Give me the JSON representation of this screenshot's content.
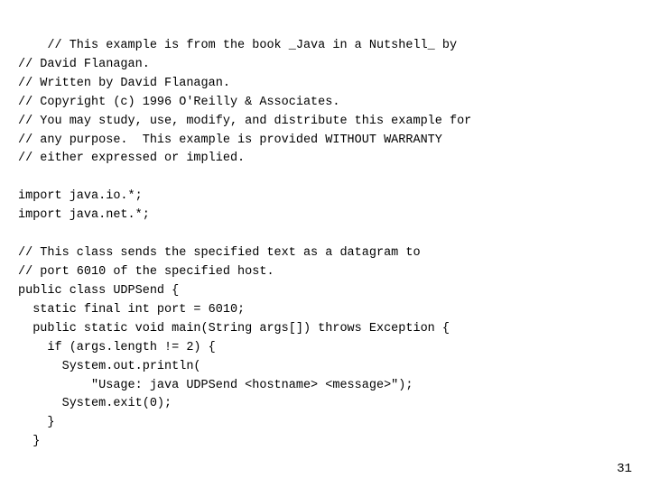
{
  "code": {
    "lines": [
      "// This example is from the book _Java in a Nutshell_ by",
      "// David Flanagan.",
      "// Written by David Flanagan.",
      "// Copyright (c) 1996 O'Reilly & Associates.",
      "// You may study, use, modify, and distribute this example for",
      "// any purpose.  This example is provided WITHOUT WARRANTY",
      "// either expressed or implied.",
      "",
      "import java.io.*;",
      "import java.net.*;",
      "",
      "// This class sends the specified text as a datagram to",
      "// port 6010 of the specified host.",
      "public class UDPSend {",
      "  static final int port = 6010;",
      "  public static void main(String args[]) throws Exception {",
      "    if (args.length != 2) {",
      "      System.out.println(",
      "          \"Usage: java UDPSend <hostname> <message>\");",
      "      System.exit(0);",
      "    }",
      "  }"
    ]
  },
  "page_number": "31"
}
